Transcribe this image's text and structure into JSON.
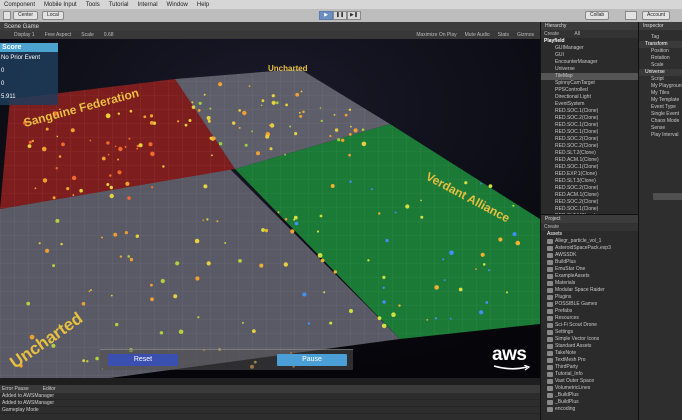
{
  "menu": [
    "Component",
    "Mobile Input",
    "Tools",
    "Tutorial",
    "Internal",
    "Window",
    "Help"
  ],
  "toolbar": {
    "pivot": "Center",
    "space": "Local",
    "collab": "Collab",
    "account": "Account",
    "layers": "Layers"
  },
  "scene": {
    "tab": "Scene  Game",
    "display": "Display 1",
    "aspect": "Free Aspect",
    "scale_label": "Scale",
    "scale_value": "0.68",
    "options": [
      "Maximize On Play",
      "Mute Audio",
      "Stats",
      "Gizmos"
    ]
  },
  "score": {
    "title": "Score",
    "lines": [
      "No Prior Event",
      "0",
      "0",
      "5.911"
    ]
  },
  "regions": {
    "top_left": "Sanguine Federation",
    "top_right": "Uncharted",
    "right": "Verdant Alliance",
    "bottom_left": "Uncharted"
  },
  "buttons": {
    "reset": "Reset",
    "pause": "Pause"
  },
  "logo": "aws",
  "console": {
    "tabs": [
      "Error Pause",
      "Editor"
    ],
    "lines": [
      "Added to AWSManager",
      "Added to AWSManager",
      "Gameplay Mode"
    ]
  },
  "hierarchy": {
    "tab": "Hierarchy",
    "create": "Create",
    "search": "All",
    "items": [
      {
        "t": "Playfield",
        "root": true
      },
      {
        "t": "GUIManager"
      },
      {
        "t": "GUI"
      },
      {
        "t": "EncounterManager"
      },
      {
        "t": "Universe"
      },
      {
        "t": "TileMap",
        "sel": true
      },
      {
        "t": "SpinnyCamTarget"
      },
      {
        "t": "PPSControlled"
      },
      {
        "t": "Directional Light"
      },
      {
        "t": "EventSystem"
      },
      {
        "t": "RED.SOC.1(Clone)"
      },
      {
        "t": "RED.SOC.2(Clone)"
      },
      {
        "t": "RED.SOC.1(Clone)"
      },
      {
        "t": "RED.SOC.1(Clone)"
      },
      {
        "t": "RED.SOC.2(Clone)"
      },
      {
        "t": "RED.SOC.2(Clone)"
      },
      {
        "t": "RED.SLT.2(Clone)"
      },
      {
        "t": "RED.ACM.1(Clone)"
      },
      {
        "t": "RED.SOC.1(Clone)"
      },
      {
        "t": "RED.EXP.1(Clone)"
      },
      {
        "t": "RED.SLT.3(Clone)"
      },
      {
        "t": "RED.SOC.2(Clone)"
      },
      {
        "t": "RED.ACM.1(Clone)"
      },
      {
        "t": "RED.SOC.2(Clone)"
      },
      {
        "t": "RED.SOC.1(Clone)"
      },
      {
        "t": "RED.SLT.1(Clone)"
      }
    ]
  },
  "project": {
    "tab": "Project",
    "create": "Create",
    "items": [
      {
        "t": "Assets",
        "root": true
      },
      {
        "t": "Allegr_particle_vol_1"
      },
      {
        "t": "AsteroidSpacePack.exp3"
      },
      {
        "t": "AWSSDK"
      },
      {
        "t": "BuildPlus"
      },
      {
        "t": "EmuStar One"
      },
      {
        "t": "ExampleAssets"
      },
      {
        "t": "Materials"
      },
      {
        "t": "Modular Space Raider"
      },
      {
        "t": "Plugins"
      },
      {
        "t": "POSSIBLE Games"
      },
      {
        "t": "Prefabs"
      },
      {
        "t": "Resources"
      },
      {
        "t": "Sci-Fi Scout Drone"
      },
      {
        "t": "Settings"
      },
      {
        "t": "Simple Vector Icons"
      },
      {
        "t": "Standard Assets"
      },
      {
        "t": "TakeNote"
      },
      {
        "t": "TextMesh Pro"
      },
      {
        "t": "ThirdParty"
      },
      {
        "t": "Tutorial_Info"
      },
      {
        "t": "Vast Outer Space"
      },
      {
        "t": "VolumetricLines"
      },
      {
        "t": "_BuildPlus"
      },
      {
        "t": "_BuildPlus"
      },
      {
        "t": "encoding"
      }
    ]
  },
  "inspector": {
    "tab": "Inspector",
    "items": [
      {
        "t": "Tag",
        "hd": false
      },
      {
        "t": "Transform",
        "hd": true
      },
      {
        "t": "Position"
      },
      {
        "t": "Rotation"
      },
      {
        "t": "Scale"
      },
      {
        "t": "Universe",
        "hd": true
      },
      {
        "t": "Script"
      },
      {
        "t": "My Playground"
      },
      {
        "t": "My Tiles"
      },
      {
        "t": "My Template"
      },
      {
        "t": "Event Type"
      },
      {
        "t": "Single Event"
      },
      {
        "t": "Chaos Mode"
      },
      {
        "t": "Sense"
      },
      {
        "t": "Play Interval"
      }
    ]
  },
  "colors": {
    "red_zone": "#8a1e1e",
    "green_zone": "#1e8a3a",
    "grey_zone": "#555560",
    "accent_blue": "#4aa0d6"
  }
}
